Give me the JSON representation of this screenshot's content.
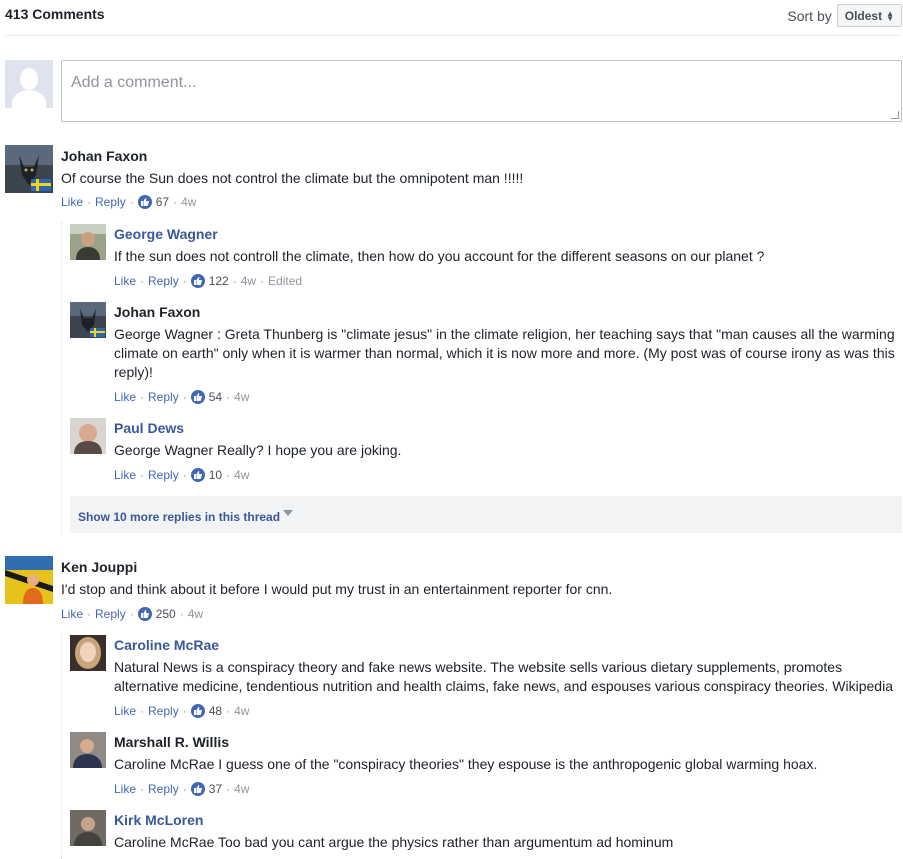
{
  "header": {
    "comment_count": "413 Comments",
    "sort_label": "Sort by",
    "sort_value": "Oldest"
  },
  "composer": {
    "placeholder": "Add a comment..."
  },
  "actions": {
    "like": "Like",
    "reply": "Reply",
    "edited": "Edited"
  },
  "comments": [
    {
      "author": "Johan Faxon",
      "text": "Of course the Sun does not control the climate but the omnipotent man !!!!!",
      "likes": "67",
      "time": "4w",
      "replies": [
        {
          "author": "George Wagner",
          "text": "If the sun does not controll the climate, then how do you account for the different seasons on our planet ?",
          "likes": "122",
          "time": "4w"
        },
        {
          "author": "Johan Faxon",
          "text": "George Wagner : Greta Thunberg is \"climate jesus\" in the climate religion, her teaching says that \"man causes all the warming climate on earth\" only when it is warmer than normal, which it is now more and more. (My post was of course irony as was this reply)!",
          "likes": "54",
          "time": "4w"
        },
        {
          "author": "Paul Dews",
          "text": "George Wagner Really? I hope you are joking.",
          "likes": "10",
          "time": "4w"
        }
      ],
      "more_replies": "Show 10 more replies in this thread"
    },
    {
      "author": "Ken Jouppi",
      "text": "I'd stop and think about it before I would put my trust in an entertainment reporter for cnn.",
      "likes": "250",
      "time": "4w",
      "replies": [
        {
          "author": "Caroline McRae",
          "text": "Natural News is a conspiracy theory and fake news website. The website sells various dietary supplements, promotes alternative medicine, tendentious nutrition and health claims, fake news, and espouses various conspiracy theories. Wikipedia",
          "likes": "48",
          "time": "4w"
        },
        {
          "author": "Marshall R. Willis",
          "text": "Caroline McRae I guess one of the \"conspiracy theories\" they espouse is the anthropogenic global warming hoax.",
          "likes": "37",
          "time": "4w"
        },
        {
          "author": "Kirk McLoren",
          "text": "Caroline McRae Too bad you cant argue the physics rather than argumentum ad hominum"
        }
      ]
    }
  ]
}
